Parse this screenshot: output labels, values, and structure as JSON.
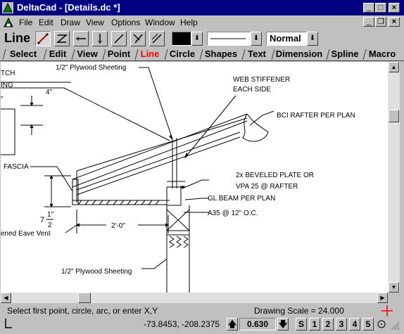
{
  "window": {
    "title": "DeltaCad - [Details.dc *]"
  },
  "menu": [
    "File",
    "Edit",
    "Draw",
    "View",
    "Options",
    "Window",
    "Help"
  ],
  "toolbar": {
    "mode_label": "Line",
    "line_style": "Normal"
  },
  "tabs": [
    "Select",
    "Edit",
    "View",
    "Point",
    "Line",
    "Circle",
    "Shapes",
    "Text",
    "Dimension",
    "Spline",
    "Macro"
  ],
  "active_tab": "Line",
  "drawing": {
    "labels": {
      "plywood_top": "1/2\" Plywood Sheeting",
      "web_stiffener_1": "WEB STIFFENER",
      "web_stiffener_2": "EACH SIDE",
      "bci_rafter": "BCI RAFTER PER PLAN",
      "fascia": "FASCIA",
      "beveled_1": "2x BEVELED PLATE OR",
      "beveled_2": "VPA 25 @ RAFTER",
      "gl_beam": "GL BEAM PER PLAN",
      "a35": "A35 @ 12\" O.C.",
      "eave_vent": "ened Eave Vent",
      "plywood_bottom": "1/2\" Plywood Sheeting",
      "dim_4": "4\"",
      "dim_2ft": "2'-0\"",
      "dim_7": "7",
      "dim_half_num": "1\"",
      "dim_half_den": "2",
      "partial_tch": "TCH",
      "partial_ing": "ING",
      "partial_quote": "\""
    }
  },
  "status": {
    "prompt": "Select first point, circle, arc, or enter X,Y",
    "scale": "Drawing Scale = 24.000",
    "coords": "-73.8453, -208.2375",
    "value": "0.630",
    "snap_buttons": [
      "S",
      "1",
      "2",
      "3",
      "4",
      "5"
    ]
  }
}
